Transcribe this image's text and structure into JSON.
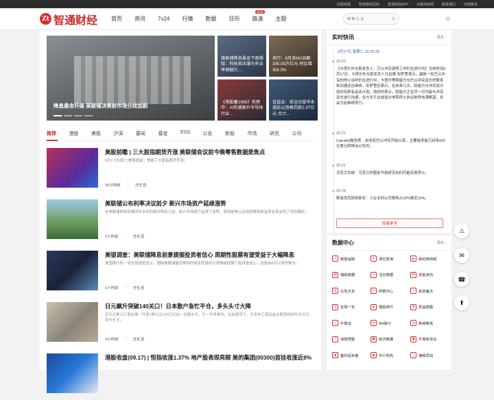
{
  "topbar": {
    "links": [
      "问题举报",
      "智通媒体招商",
      "智通财经APP",
      "大路演官网",
      "联系我们",
      "切换繁体"
    ]
  },
  "nav": {
    "logo_mark": "Zt",
    "logo_text": "智通财经",
    "items": [
      "首页",
      "资讯",
      "7x24",
      "行情",
      "数据",
      "日历",
      "路演",
      "主题"
    ],
    "badge": "NEW",
    "search_placeholder": "搜 索 行 业"
  },
  "hero": {
    "caption": "降息悬念升级 美联储决策前市场分歧加剧"
  },
  "tiles": [
    {
      "title": "美联储降息悬念下周揭晓：科技卖压潮与失业率预期万..."
    },
    {
      "title": "央行：8月末M2余额305.05万亿元 同比增长6.3%"
    },
    {
      "title": "《港股蓄1996》热榜中：AI热潮推升半导体行业..."
    },
    {
      "title": "证监会：依法对普华永道处以顶格罚款2.97亿元 合计..."
    }
  ],
  "tabs": [
    "推荐",
    "港股",
    "美股",
    "沪深",
    "要闻",
    "基金",
    "ESG",
    "公告",
    "新股",
    "市场",
    "研究",
    "公司"
  ],
  "articles": [
    {
      "title": "美股前瞻 | 三大股指期货齐涨 美联储会议前今晚零售数据是焦点",
      "summary": "9月17日(周二)美股盘前，美股三大股指期货齐涨。",
      "time": "36分钟前",
      "author": "庄礼佳"
    },
    {
      "title": "美联储公布利率决议前夕 新兴市场资产延续涨势",
      "summary": "在美联储即将实施四年多来的首次降息之前，新兴市场资产延续了涨势，原因是美元走软和美债收益率走低支撑了风险偏好。",
      "time": "1小时前",
      "author": "庄礼佳"
    },
    {
      "title": "美银调查：美联储降息前景提振投资者信心 周期性股票有望受益于大幅降息",
      "summary": "美国银行的一项全球调查显示，围绕美联储备受期待的降息举措的乐观情绪提振了投资者信心，这是自6月以来的首次。",
      "time": "1小时前",
      "author": "庄礼佳"
    },
    {
      "title": "日元飙升突破140关口！日本散户急忙平仓，多头头寸大降",
      "summary": "日元兑美元汇率在周一升穿1美元兑140日元这一关键水平，为一年来首次。在此情况下，日本外汇保证金交易员纷纷平仓日元多头头寸。",
      "time": "3小时前",
      "author": "庄礼佳"
    },
    {
      "title": "港股收盘(09.17) | 恒指收涨1.37% 地产股表现亮眼 美的集团(00300)首挂收涨近8%",
      "summary": "",
      "time": "",
      "author": ""
    }
  ],
  "live": {
    "title": "实时快讯",
    "more": "更多",
    "date": "9月17日 星期二 20:25:28",
    "items": [
      {
        "time": "20:22",
        "text": "【卡塔尔外交部发言人：已以冲突调停工作仍在进行中】当地时间9月17日，卡塔尔外交部发言人马吉德·安萨里表示，最新一轮巴以冲突的停火谈判仍在进行中，卡塔尔等斡旋方与巴以冲突双方的联系和沟通还在继续。安萨里还表示，在未来几天，斡旋方与冲突双方就时间表有会谈计划。他同时表示，斡旋方正在尽一切可能与冲突双方进行沟通，全方对于达成加沙地带停火协议依然充满希望，并会为此继续努力。"
      },
      {
        "time": "20:21",
        "text": "Calcalist报告称，自本轮巴以冲突开始以来，主要投资者已经将400亿美元转移出以色列。"
      },
      {
        "time": "20:21",
        "text": "乌克兰总统：乌克兰的盟友开始研究如何可能实现停火。"
      },
      {
        "time": "20:18",
        "text": "斯洛伐克财政部长：小企业的公司税将从15%降至10%。"
      }
    ],
    "more_button": "查看更多"
  },
  "data_center": {
    "title": "数据中心",
    "more": "更多",
    "items": [
      "新股追踪",
      "涡位查询",
      "经纪商持股",
      "港股数据",
      "沽空数据",
      "资金流向",
      "公告大全",
      "研报中心",
      "投资备忘",
      "全球一览",
      "强股排行",
      "权益披露",
      "牛熊证",
      "AH股计",
      "新高新低",
      "违规预警",
      "经济数据",
      "牛熊街货比",
      "基石投资者",
      "中介机构",
      "港股异动"
    ]
  },
  "float_icons": [
    "warning-icon",
    "chat-icon",
    "headset-icon",
    "back-to-top-icon"
  ]
}
